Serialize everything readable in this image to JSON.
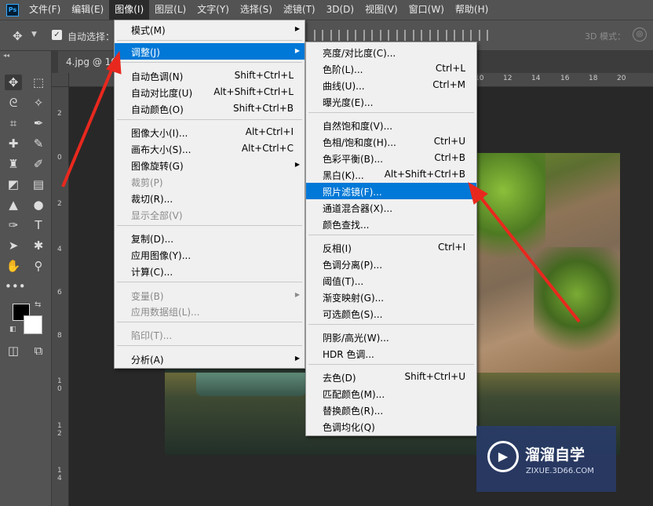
{
  "app": {
    "logo": "Ps"
  },
  "menubar": {
    "items": [
      "文件(F)",
      "编辑(E)",
      "图像(I)",
      "图层(L)",
      "文字(Y)",
      "选择(S)",
      "滤镜(T)",
      "3D(D)",
      "视图(V)",
      "窗口(W)",
      "帮助(H)"
    ],
    "active": "图像(I)"
  },
  "options": {
    "auto_select_label": "自动选择：",
    "auto_select_checked": true,
    "mode3d_label": "3D 模式："
  },
  "document": {
    "tab_title": "4.jpg @ 10"
  },
  "rulers": {
    "top": [
      "10",
      "12",
      "14",
      "16",
      "18",
      "20"
    ],
    "left": [
      "2",
      "0",
      "2",
      "4",
      "6",
      "8",
      "1 0",
      "1 2",
      "1 4"
    ]
  },
  "image_menu": {
    "items": [
      {
        "label": "模式(M)",
        "shortcut": "",
        "submenu": true,
        "disabled": false
      },
      {
        "label": "调整(J)",
        "shortcut": "",
        "submenu": true,
        "disabled": false,
        "highlighted": true
      },
      {
        "label": "自动色调(N)",
        "shortcut": "Shift+Ctrl+L"
      },
      {
        "label": "自动对比度(U)",
        "shortcut": "Alt+Shift+Ctrl+L"
      },
      {
        "label": "自动颜色(O)",
        "shortcut": "Shift+Ctrl+B"
      },
      {
        "label": "图像大小(I)...",
        "shortcut": "Alt+Ctrl+I"
      },
      {
        "label": "画布大小(S)...",
        "shortcut": "Alt+Ctrl+C"
      },
      {
        "label": "图像旋转(G)",
        "shortcut": "",
        "submenu": true
      },
      {
        "label": "裁剪(P)",
        "shortcut": "",
        "disabled": true
      },
      {
        "label": "裁切(R)...",
        "shortcut": ""
      },
      {
        "label": "显示全部(V)",
        "shortcut": "",
        "disabled": true
      },
      {
        "label": "复制(D)...",
        "shortcut": ""
      },
      {
        "label": "应用图像(Y)...",
        "shortcut": ""
      },
      {
        "label": "计算(C)...",
        "shortcut": ""
      },
      {
        "label": "变量(B)",
        "shortcut": "",
        "submenu": true,
        "disabled": true
      },
      {
        "label": "应用数据组(L)...",
        "shortcut": "",
        "disabled": true
      },
      {
        "label": "陷印(T)...",
        "shortcut": "",
        "disabled": true
      },
      {
        "label": "分析(A)",
        "shortcut": "",
        "submenu": true
      }
    ]
  },
  "adjust_menu": {
    "items": [
      {
        "label": "亮度/对比度(C)...",
        "shortcut": ""
      },
      {
        "label": "色阶(L)...",
        "shortcut": "Ctrl+L"
      },
      {
        "label": "曲线(U)...",
        "shortcut": "Ctrl+M"
      },
      {
        "label": "曝光度(E)...",
        "shortcut": ""
      },
      {
        "label": "自然饱和度(V)...",
        "shortcut": ""
      },
      {
        "label": "色相/饱和度(H)...",
        "shortcut": "Ctrl+U"
      },
      {
        "label": "色彩平衡(B)...",
        "shortcut": "Ctrl+B"
      },
      {
        "label": "黑白(K)...",
        "shortcut": "Alt+Shift+Ctrl+B"
      },
      {
        "label": "照片滤镜(F)...",
        "shortcut": "",
        "highlighted": true
      },
      {
        "label": "通道混合器(X)...",
        "shortcut": ""
      },
      {
        "label": "颜色查找...",
        "shortcut": ""
      },
      {
        "label": "反相(I)",
        "shortcut": "Ctrl+I"
      },
      {
        "label": "色调分离(P)...",
        "shortcut": ""
      },
      {
        "label": "阈值(T)...",
        "shortcut": ""
      },
      {
        "label": "渐变映射(G)...",
        "shortcut": ""
      },
      {
        "label": "可选颜色(S)...",
        "shortcut": ""
      },
      {
        "label": "阴影/高光(W)...",
        "shortcut": ""
      },
      {
        "label": "HDR 色调...",
        "shortcut": ""
      },
      {
        "label": "去色(D)",
        "shortcut": "Shift+Ctrl+U"
      },
      {
        "label": "匹配颜色(M)...",
        "shortcut": ""
      },
      {
        "label": "替换颜色(R)...",
        "shortcut": ""
      },
      {
        "label": "色调均化(Q)",
        "shortcut": ""
      }
    ]
  },
  "watermark": {
    "title": "溜溜自学",
    "url": "ZIXUE.3D66.COM"
  },
  "colors": {
    "highlight": "#0078d7",
    "annotation_arrow": "#e8281e"
  }
}
